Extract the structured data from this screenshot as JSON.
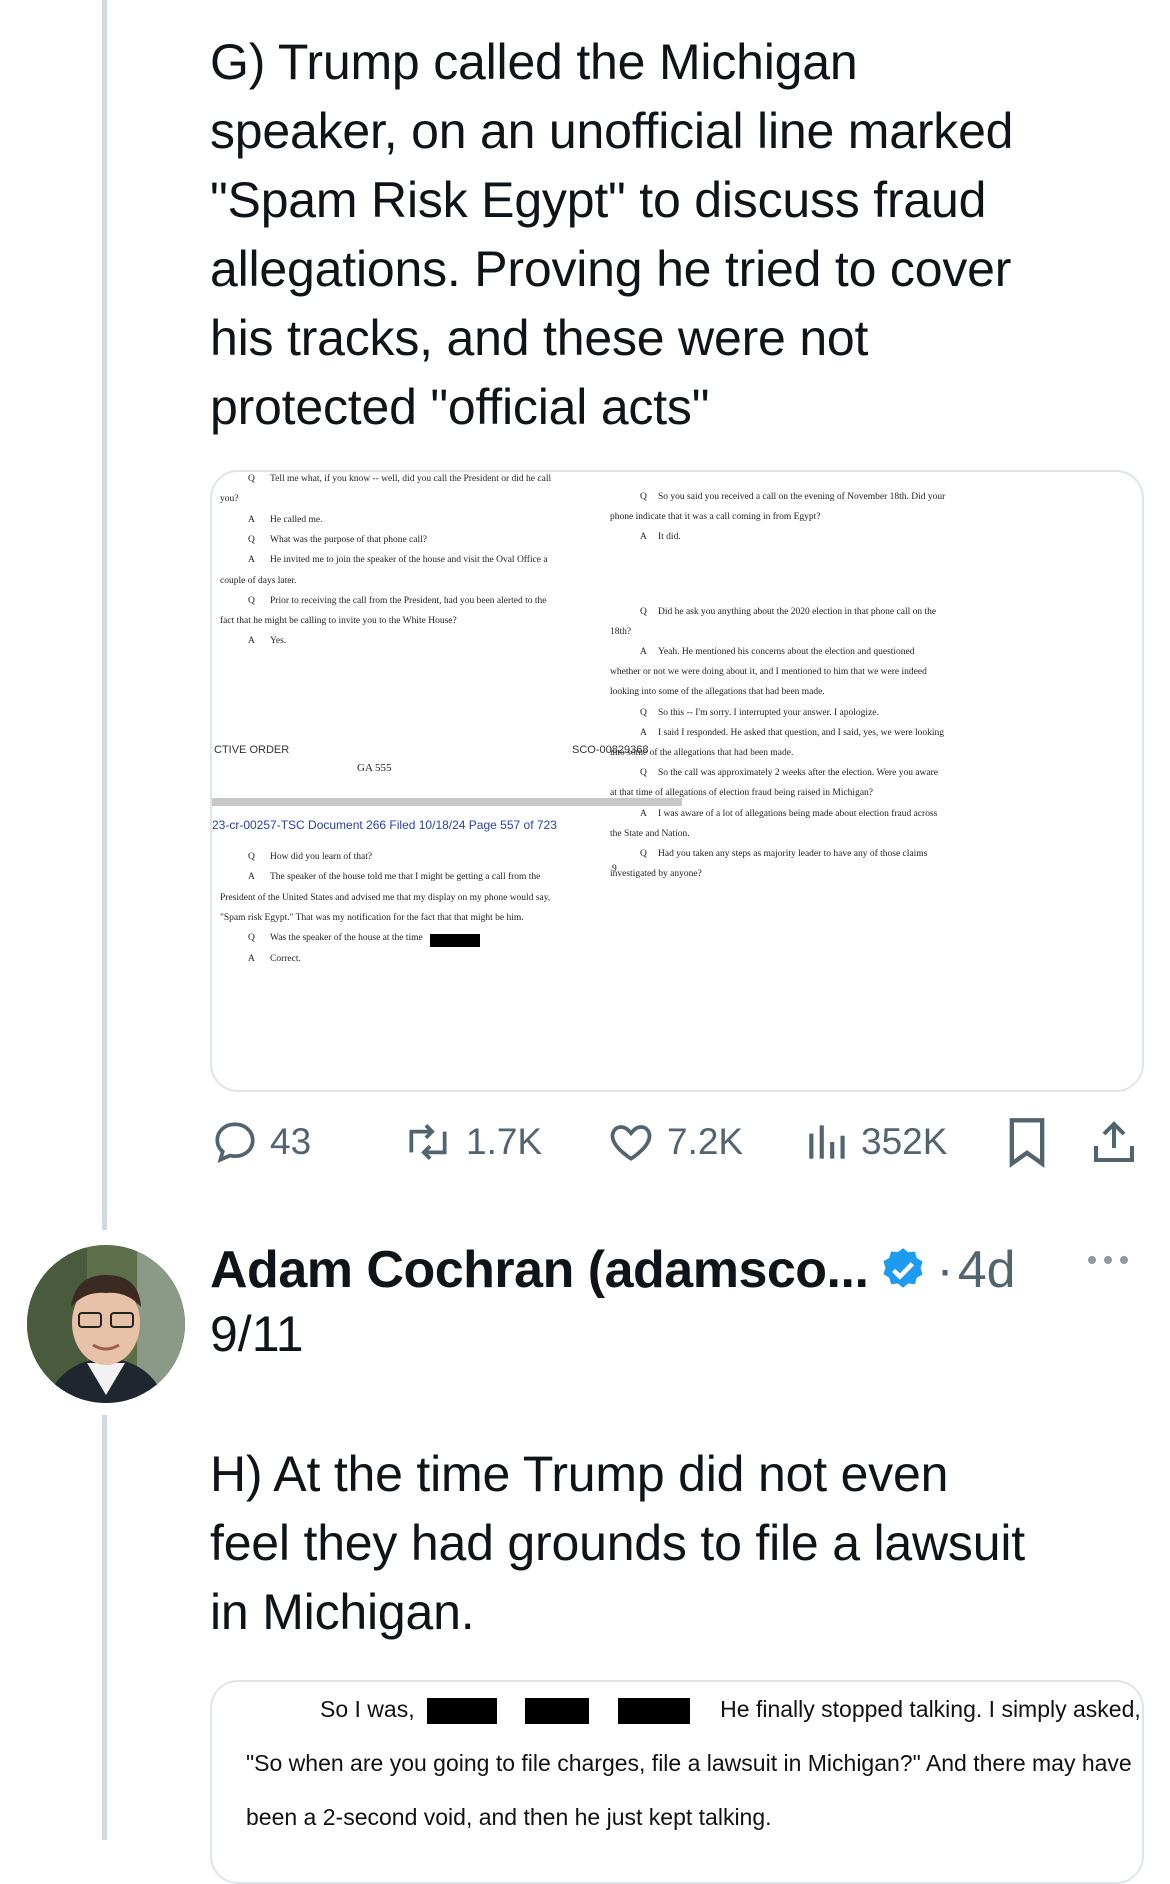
{
  "tweet1": {
    "text": "G) Trump called the Michigan\nspeaker, on an unofficial line marked\n\"Spam Risk Egypt\" to discuss fraud\nallegations. Proving he tried to cover\nhis tracks, and these were not\nprotected \"official acts\"",
    "doc": {
      "left": [
        {
          "q": "Q",
          "t": "Tell me what, if you know -- well, did you call the President or did he call"
        },
        {
          "q": "",
          "t": "you?"
        },
        {
          "q": "A",
          "t": "He called me."
        },
        {
          "q": "Q",
          "t": "What was the purpose of that phone call?"
        },
        {
          "q": "A",
          "t": "He invited me to join the speaker of the house and visit the Oval Office a"
        },
        {
          "q": "",
          "t": "couple of days later."
        },
        {
          "q": "Q",
          "t": "Prior to receiving the call from the President, had you been alerted to the"
        },
        {
          "q": "",
          "t": "fact that he might be calling to invite you to the White House?"
        },
        {
          "q": "A",
          "t": "Yes."
        }
      ],
      "footer_left": "CTIVE ORDER",
      "footer_right": "SCO-00829368",
      "footer_mid": "GA 555",
      "filing": "23-cr-00257-TSC   Document 266   Filed 10/18/24   Page 557 of 723",
      "page_no": "9",
      "left_bottom": [
        {
          "q": "Q",
          "t": "How did you learn of that?"
        },
        {
          "q": "A",
          "t": "The speaker of the house told me that I might be getting a call from the"
        },
        {
          "q": "",
          "t": "President of the United States and advised me that my display on my phone would say,"
        },
        {
          "q": "",
          "t": "\"Spam risk Egypt.\"   That was my notification for the fact that that might be him."
        },
        {
          "q": "Q",
          "t": "Was the speaker of the house at the time"
        },
        {
          "q": "A",
          "t": "Correct."
        }
      ],
      "right": [
        {
          "q": "Q",
          "t": "So you said you received a call on the evening of November 18th.   Did your"
        },
        {
          "q": "",
          "t": "phone indicate that it was a call coming in from Egypt?"
        },
        {
          "q": "A",
          "t": "It did."
        },
        {
          "q": "Q",
          "t": "Did he ask you anything about the 2020 election in that phone call on the"
        },
        {
          "q": "",
          "t": "18th?"
        },
        {
          "q": "A",
          "t": "Yeah.   He mentioned his concerns about the election and questioned"
        },
        {
          "q": "",
          "t": "whether or not we were doing about it, and I mentioned to him that we were indeed"
        },
        {
          "q": "",
          "t": "looking into some of the allegations that had been made."
        },
        {
          "q": "Q",
          "t": "So this -- I'm sorry.   I interrupted your answer.   I apologize."
        },
        {
          "q": "A",
          "t": "I said I responded.   He asked that question, and I said, yes, we were looking"
        },
        {
          "q": "",
          "t": "into some of the allegations that had been made."
        },
        {
          "q": "Q",
          "t": "So the call was approximately 2 weeks after the election.   Were you aware"
        },
        {
          "q": "",
          "t": "at that time of allegations of election fraud being raised in Michigan?"
        },
        {
          "q": "A",
          "t": "I was aware of a lot of allegations being made about election fraud across"
        },
        {
          "q": "",
          "t": "the State and Nation."
        },
        {
          "q": "Q",
          "t": "Had you taken any steps as majority leader to have any of those claims"
        },
        {
          "q": "",
          "t": "investigated by anyone?"
        }
      ]
    },
    "stats": {
      "replies": "43",
      "retweets": "1.7K",
      "likes": "7.2K",
      "views": "352K"
    }
  },
  "tweet2": {
    "author": "Adam Cochran (adamsco...",
    "time": "4d",
    "dot": "·",
    "thread_count": "9/11",
    "text": "H) At the time Trump did not even\nfeel they had grounds to file a lawsuit\nin Michigan.",
    "doc": {
      "line1_a": "So I was,",
      "line1_b": "He finally stopped talking.   I simply asked,",
      "line2": "\"So when are you going to file charges, file a lawsuit in Michigan?\"   And there may have",
      "line3": "been a 2-second void, and then he just kept talking."
    }
  },
  "colors": {
    "text": "#0f1419",
    "secondary": "#536471",
    "thread_line": "#cfd9de",
    "verified": "#1d9bf0",
    "border": "#dfe5e9"
  },
  "icons": [
    "reply-icon",
    "retweet-icon",
    "like-icon",
    "views-icon",
    "bookmark-icon",
    "share-icon",
    "verified-badge-icon",
    "more-icon"
  ]
}
